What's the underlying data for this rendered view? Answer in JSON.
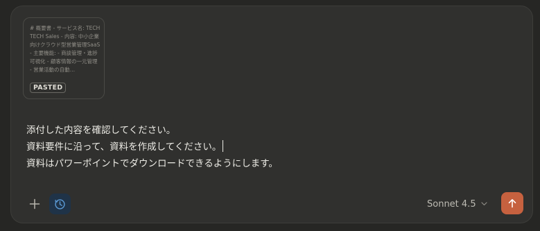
{
  "paste_card": {
    "preview_text": "# 概要書 - サービス名: TECH TECH Sales - 内容: 中小企業向けクラウド型営業管理SaaS - 主要機能: - 商談管理・進捗可視化 - 顧客情報の一元管理 - 営業活動の自動…",
    "badge_label": "PASTED"
  },
  "message": {
    "lines": [
      "添付した内容を確認してください。",
      "資料要件に沿って、資料を作成してください。",
      "資料はパワーポイントでダウンロードできるようにします。"
    ]
  },
  "toolbar": {
    "add_icon": "plus-icon",
    "history_icon": "clock-icon",
    "model_label": "Sonnet 4.5",
    "model_icon": "chevron-down-icon",
    "send_icon": "arrow-up-icon"
  },
  "colors": {
    "background": "#262624",
    "composer": "#30302e",
    "send_button": "#c6613f",
    "active_tool": "#1f3348",
    "active_tool_icon": "#5b9bd6"
  }
}
